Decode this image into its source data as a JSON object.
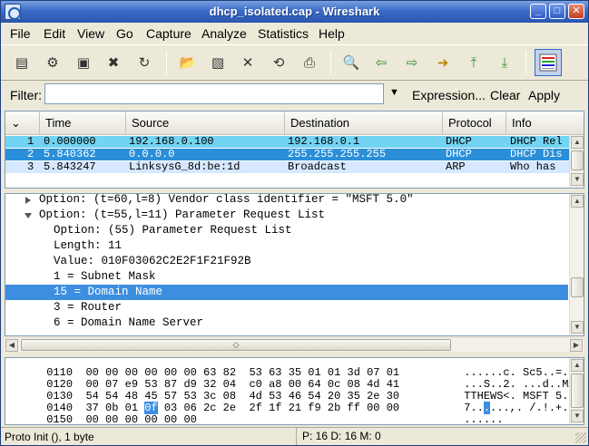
{
  "window": {
    "title": "dhcp_isolated.cap - Wireshark"
  },
  "menu": [
    "File",
    "Edit",
    "View",
    "Go",
    "Capture",
    "Analyze",
    "Statistics",
    "Help"
  ],
  "toolbar": {
    "icons": [
      "list-interfaces-icon",
      "capture-options-icon",
      "start-capture-icon",
      "stop-capture-icon",
      "restart-capture-icon",
      "open-file-icon",
      "save-file-icon",
      "close-file-icon",
      "reload-icon",
      "print-icon",
      "find-packet-icon",
      "go-back-icon",
      "go-forward-icon",
      "go-to-packet-icon",
      "go-first-icon",
      "go-last-icon",
      "colorize-icon"
    ]
  },
  "filter": {
    "label": "Filter:",
    "value": "",
    "expression": "Expression...",
    "clear": "Clear",
    "apply": "Apply"
  },
  "packet_list": {
    "columns": [
      "Time",
      "Source",
      "Destination",
      "Protocol",
      "Info"
    ],
    "rows": [
      {
        "no": "1",
        "time": "0.000000",
        "source": "192.168.0.100",
        "destination": "192.168.0.1",
        "protocol": "DHCP",
        "info": "DHCP Rel"
      },
      {
        "no": "2",
        "time": "5.840362",
        "source": "0.0.0.0",
        "destination": "255.255.255.255",
        "protocol": "DHCP",
        "info": "DHCP Dis"
      },
      {
        "no": "3",
        "time": "5.843247",
        "source": "LinksysG_8d:be:1d",
        "destination": "Broadcast",
        "protocol": "ARP",
        "info": "Who has"
      }
    ]
  },
  "details": {
    "lines": [
      {
        "text": "Option: (t=60,l=8) Vendor class identifier = \"MSFT 5.0\"",
        "expander": "collapsed"
      },
      {
        "text": "Option: (t=55,l=11) Parameter Request List",
        "expander": "expanded"
      },
      {
        "text": "Option: (55) Parameter Request List",
        "expander": "none"
      },
      {
        "text": "Length: 11",
        "expander": "none"
      },
      {
        "text": "Value: 010F03062C2E2F1F21F92B",
        "expander": "none"
      },
      {
        "text": "1 = Subnet Mask",
        "expander": "none"
      },
      {
        "text": "15 = Domain Name",
        "expander": "none"
      },
      {
        "text": "3 = Router",
        "expander": "none"
      },
      {
        "text": "6 = Domain Name Server",
        "expander": "none"
      }
    ],
    "selected_line": "15 = Domain Name"
  },
  "hex": {
    "rows": [
      {
        "offset": "0110",
        "a": "00 00 00 00 00 00 63 82",
        "b": "53 63 35 01 01 3d 07 01",
        "asc_a": "......c.",
        "asc_b": "Sc5..=.."
      },
      {
        "offset": "0120",
        "a": "00 07 e9 53 87 d9 32 04",
        "b": "c0 a8 00 64 0c 08 4d 41",
        "asc_a": "...S..2.",
        "asc_b": "...d..MA"
      },
      {
        "offset": "0130",
        "a": "54 54 48 45 57 53 3c 08",
        "b": "4d 53 46 54 20 35 2e 30",
        "asc_a": "TTHEWS<.",
        "asc_b": "MSFT 5.0"
      },
      {
        "offset": "0140",
        "a_pre": "37 0b 01 ",
        "a_hl": "0f",
        "a_post": " 03 06 2c 2e",
        "b": "2f 1f 21 f9 2b ff 00 00",
        "asc_a_pre": "7..",
        "asc_a_hl": ".",
        "asc_a_post": "...,.",
        "asc_b": "/.!.+..."
      },
      {
        "offset": "0150",
        "a": "00 00 00 00 00 00",
        "b": "",
        "asc_a": "......",
        "asc_b": ""
      }
    ]
  },
  "status": {
    "left": "Proto Init (), 1 byte",
    "right": "P: 16 D: 16 M: 0"
  }
}
